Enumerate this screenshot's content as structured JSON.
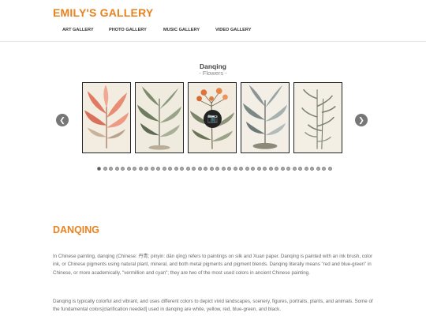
{
  "site": {
    "title": "EMILY'S GALLERY"
  },
  "nav": [
    {
      "label": "ART GALLERY"
    },
    {
      "label": "PHOTO GALLERY"
    },
    {
      "label": "MUSIC GALLERY"
    },
    {
      "label": "VIDEO GALLERY"
    }
  ],
  "gallery": {
    "title": "Danqing",
    "subtitle": "- Flowers -",
    "prev_icon": "chevron-left-icon",
    "next_icon": "chevron-right-icon",
    "camera_icon": "camera-icon",
    "dot_count": 40,
    "active_dot": 0
  },
  "article": {
    "heading": "DANQING",
    "paragraph1": "In Chinese painting, danqing (Chinese: 丹青; pinyin: dān qīng) refers to paintings on silk and Xuan paper. Danqing is painted with an ink brush, color ink, or Chinese pigments using natural plant, mineral, and both metal pigments and pigment blends. Danqing literally means \"red and blue-green\" in Chinese, or more academically, \"vermillion and cyan\"; they are two of the most used colors in ancient Chinese painting.",
    "paragraph2": "Danqing is typically colorful and vibrant, and uses different colors to depict vivid landscapes, scenery, figures, portraits, plants, and animals. Some of the fundamental colors[clarification needed] used in danqing are white, yellow, red, blue-green, and black."
  },
  "colors": {
    "accent": "#e8821e",
    "text": "#6a6a6a"
  }
}
